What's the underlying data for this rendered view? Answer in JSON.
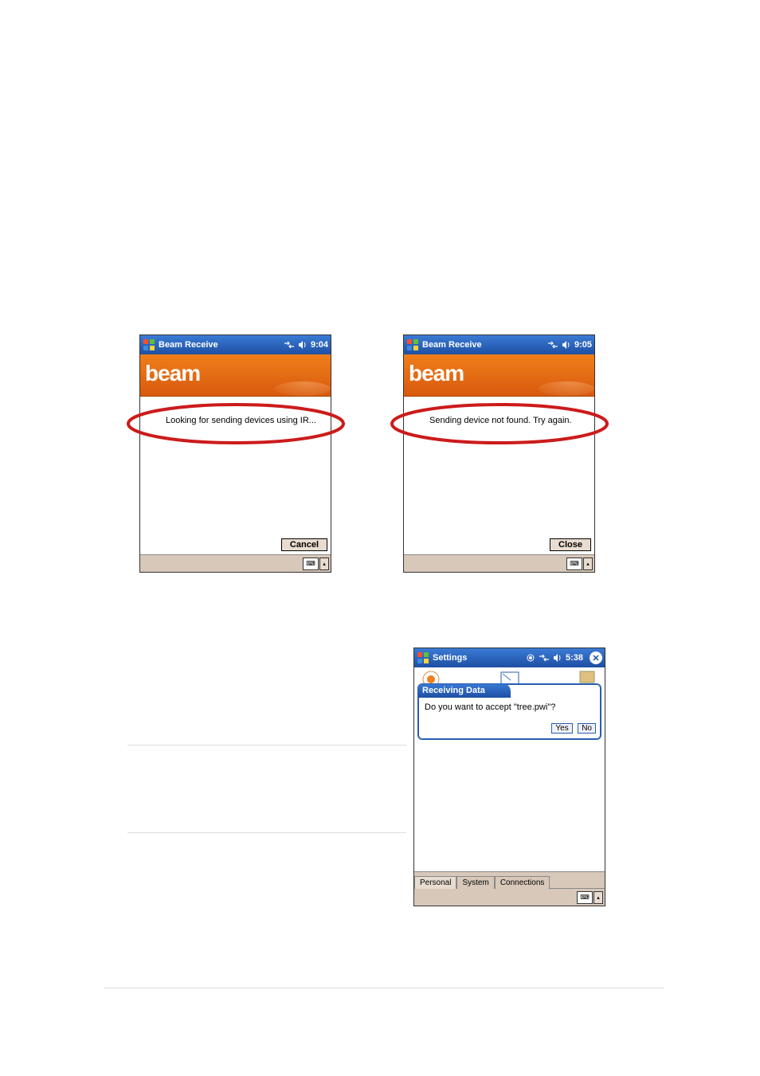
{
  "device1": {
    "title": "Beam Receive",
    "clock": "9:04",
    "banner": "beam",
    "status_text": "Looking for sending devices using IR...",
    "button_label": "Cancel"
  },
  "device2": {
    "title": "Beam Receive",
    "clock": "9:05",
    "banner": "beam",
    "status_text": "Sending device not found. Try again.",
    "button_label": "Close"
  },
  "device3": {
    "title": "Settings",
    "clock": "5:38",
    "dialog_title": "Receiving Data",
    "dialog_message": "Do you want to accept \"tree.pwi\"?",
    "yes_label": "Yes",
    "no_label": "No",
    "tabs": [
      "Personal",
      "System",
      "Connections"
    ]
  },
  "icons": {
    "connectivity": "⇄",
    "speaker": "🔈",
    "keyboard": "⌨"
  }
}
